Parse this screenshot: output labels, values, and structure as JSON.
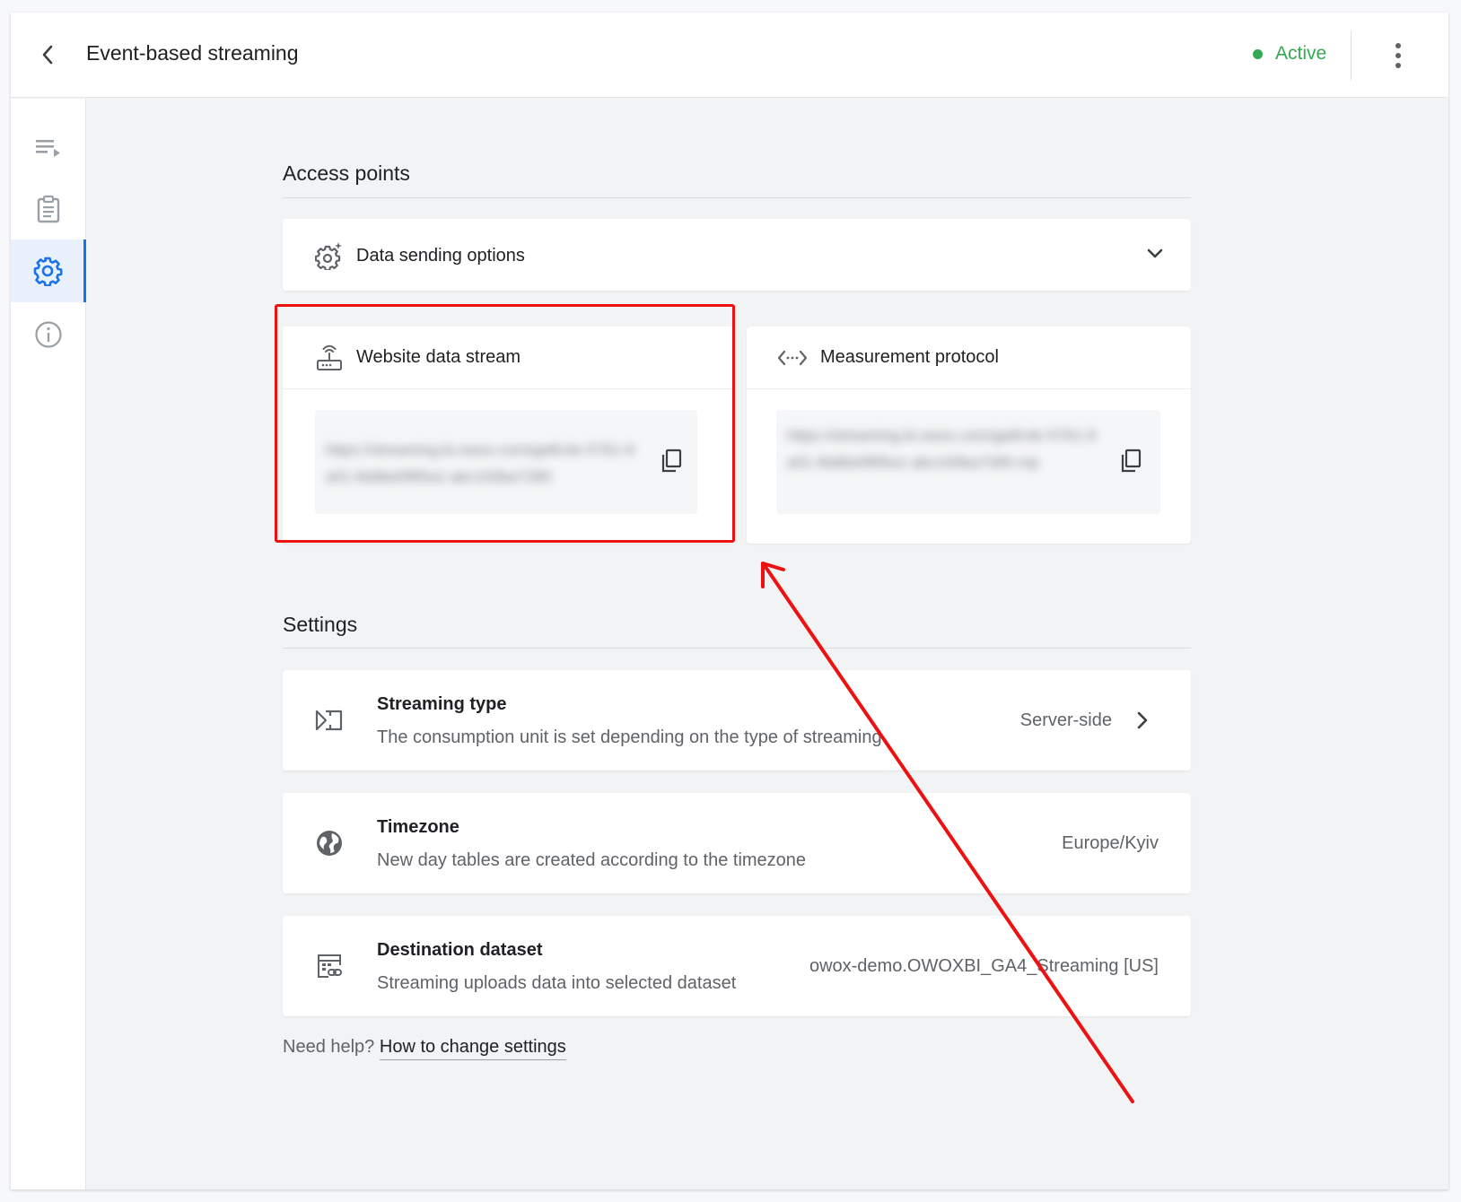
{
  "header": {
    "title": "Event-based streaming",
    "status": "Active",
    "colors": {
      "status": "#34a853",
      "accent": "#1a73e8",
      "annotation": "#ee1111"
    }
  },
  "sidebar": {
    "items": [
      {
        "icon": "playlist-play-icon",
        "active": false
      },
      {
        "icon": "clipboard-icon",
        "active": false
      },
      {
        "icon": "gear-icon",
        "active": true
      },
      {
        "icon": "info-icon",
        "active": false
      }
    ]
  },
  "access_points": {
    "title": "Access points",
    "data_sending_options": {
      "label": "Data sending options",
      "icon": "gear-sparkle-icon"
    },
    "website_stream": {
      "title": "Website data stream",
      "icon": "router-icon",
      "url": "https://streaming.bi.owox.com/gatfc4e-5761-9a51-8ddbd3f95a1-abc193ba7280"
    },
    "measurement_protocol": {
      "title": "Measurement protocol",
      "icon": "code-arrows-icon",
      "url": "https://streaming.bi.owox.com/gatfc4e-5761-9a51-8ddbd3f95a1-abc193ba7280-mp"
    }
  },
  "settings": {
    "title": "Settings",
    "rows": [
      {
        "title": "Streaming type",
        "description": "The consumption unit is set depending on the type of streaming",
        "value": "Server-side",
        "icon": "streaming-icon"
      },
      {
        "title": "Timezone",
        "description": "New day tables are created according to the timezone",
        "value": "Europe/Kyiv",
        "icon": "globe-icon"
      },
      {
        "title": "Destination dataset",
        "description": "Streaming uploads data into selected dataset",
        "value": "owox-demo.OWOXBI_GA4_Streaming [US]",
        "icon": "dataset-link-icon"
      }
    ]
  },
  "help": {
    "prefix": "Need help? ",
    "link": "How to change settings"
  }
}
